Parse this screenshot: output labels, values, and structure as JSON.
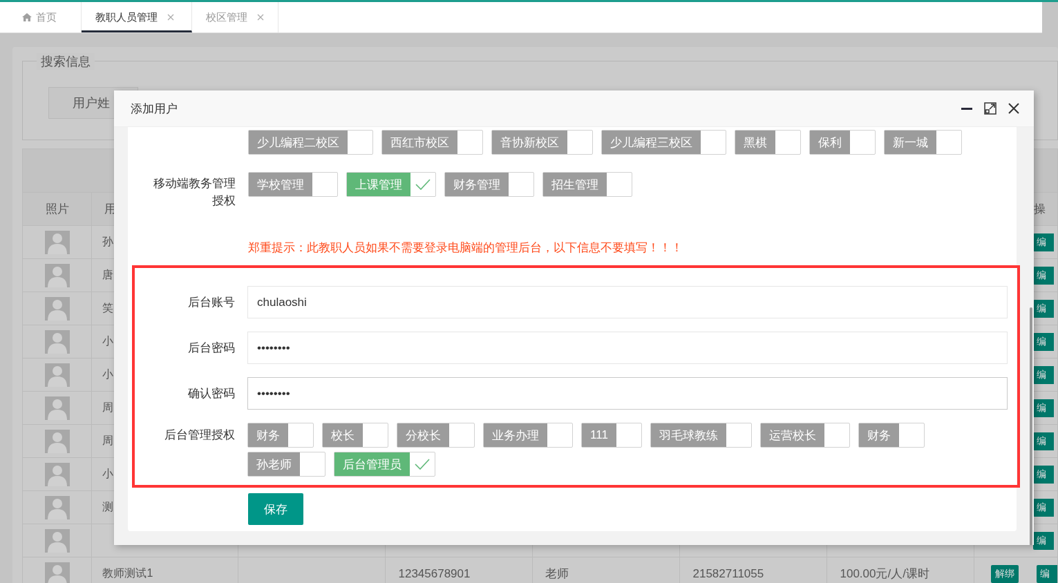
{
  "tabs": [
    {
      "label": "首页",
      "kind": "home",
      "selected": false
    },
    {
      "label": "教职人员管理",
      "kind": "page",
      "selected": true
    },
    {
      "label": "校区管理",
      "kind": "page",
      "selected": false
    }
  ],
  "background": {
    "search_legend": "搜索信息",
    "search_field": "用户姓",
    "table": {
      "columns": [
        "照片",
        "用",
        "操"
      ],
      "rows": [
        {
          "name": "孙",
          "edit": "编"
        },
        {
          "name": "唐",
          "edit": "编"
        },
        {
          "name": "笑",
          "edit": "编"
        },
        {
          "name": "小",
          "edit": "编"
        },
        {
          "name": "小",
          "edit": "编"
        },
        {
          "name": "周",
          "edit": "编"
        },
        {
          "name": "周",
          "edit": "编"
        },
        {
          "name": "小",
          "edit": "编"
        },
        {
          "name": "测",
          "edit": "编"
        },
        {
          "edit": "编"
        },
        {
          "name": "教师测试1",
          "cells": [
            "12345678901",
            "老师",
            "21582711055",
            "100.00元/人/课时"
          ],
          "unbind": "解绑",
          "edit": "编"
        }
      ]
    }
  },
  "dialog": {
    "title": "添加用户",
    "groups": [
      {
        "options": [
          {
            "label": "少儿编程二校区",
            "checked": false
          },
          {
            "label": "西红市校区",
            "checked": false
          },
          {
            "label": "音协新校区",
            "checked": false
          },
          {
            "label": "少儿编程三校区",
            "checked": false
          },
          {
            "label": "黑棋",
            "checked": false
          },
          {
            "label": "保利",
            "checked": false
          },
          {
            "label": "新一城",
            "checked": false
          }
        ]
      },
      {
        "label": "移动端教务管理授权",
        "options": [
          {
            "label": "学校管理",
            "checked": false
          },
          {
            "label": "上课管理",
            "checked": true
          },
          {
            "label": "财务管理",
            "checked": false
          },
          {
            "label": "招生管理",
            "checked": false
          }
        ]
      }
    ],
    "notice": "郑重提示：此教职人员如果不需要登录电脑端的管理后台，以下信息不要填写！！！",
    "fields": [
      {
        "label": "后台账号",
        "value": "chulaoshi",
        "focused": false
      },
      {
        "label": "后台密码",
        "value": "••••••••",
        "focused": false
      },
      {
        "label": "确认密码",
        "value": "••••••••",
        "focused": true
      }
    ],
    "roles": {
      "label": "后台管理授权",
      "options": [
        {
          "label": "财务",
          "checked": false
        },
        {
          "label": "校长",
          "checked": false
        },
        {
          "label": "分校长",
          "checked": false
        },
        {
          "label": "业务办理",
          "checked": false
        },
        {
          "label": "111",
          "checked": false
        },
        {
          "label": "羽毛球教练",
          "checked": false
        },
        {
          "label": "运营校长",
          "checked": false
        },
        {
          "label": "财务",
          "checked": false
        },
        {
          "label": "孙老师",
          "checked": false
        },
        {
          "label": "后台管理员",
          "checked": true
        }
      ]
    },
    "save": "保存"
  }
}
